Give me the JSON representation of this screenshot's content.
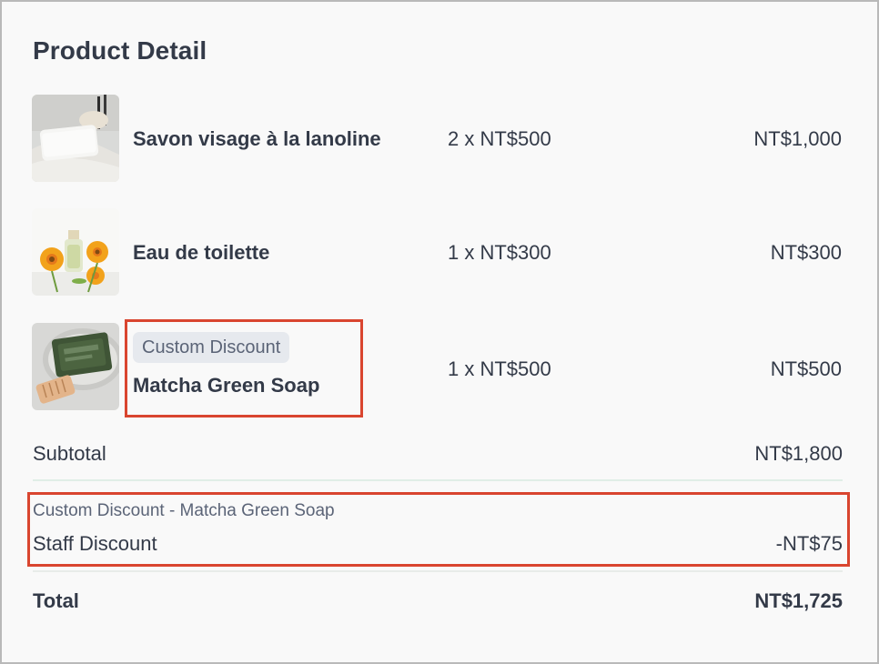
{
  "panel": {
    "title": "Product Detail"
  },
  "items": [
    {
      "name": "Savon visage à la lanoline",
      "quantity_price": "2 x NT$500",
      "line_total": "NT$1,000",
      "image": "soap-bar-image"
    },
    {
      "name": "Eau de toilette",
      "quantity_price": "1 x NT$300",
      "line_total": "NT$300",
      "image": "perfume-flowers-image"
    },
    {
      "name": "Matcha Green Soap",
      "tag": "Custom Discount",
      "quantity_price": "1 x NT$500",
      "line_total": "NT$500",
      "image": "green-soap-image"
    }
  ],
  "subtotal": {
    "label": "Subtotal",
    "value": "NT$1,800"
  },
  "discount": {
    "source": "Custom Discount - Matcha Green Soap",
    "label": "Staff Discount",
    "value": "-NT$75"
  },
  "total": {
    "label": "Total",
    "value": "NT$1,725"
  },
  "colors": {
    "highlight": "#d9452f",
    "text": "#333a48",
    "muted": "#5b6477",
    "tag_bg": "#e6e9ee"
  }
}
